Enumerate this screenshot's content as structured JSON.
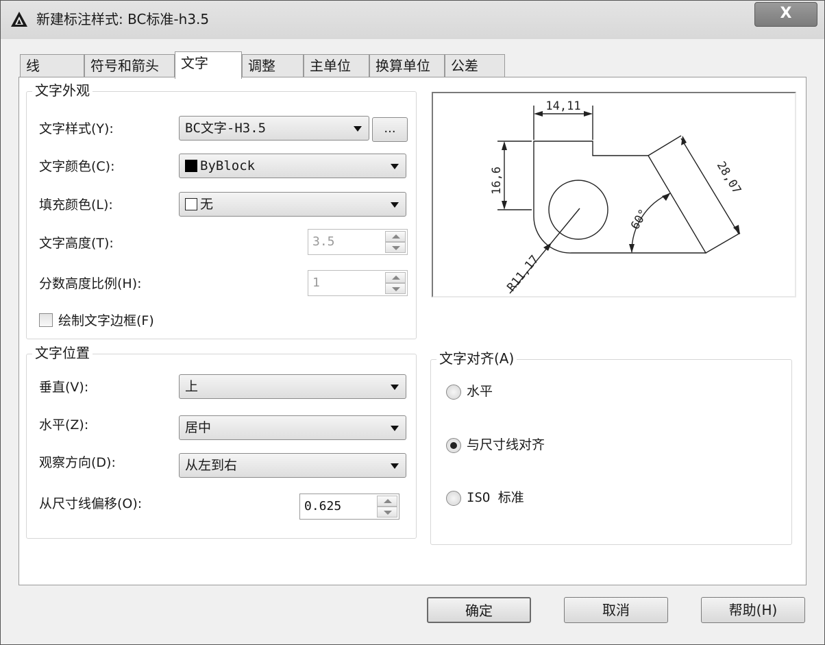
{
  "window": {
    "title": "新建标注样式: BC标准-h3.5",
    "close_label": "X"
  },
  "tabs": [
    {
      "label": "线",
      "active": false
    },
    {
      "label": "符号和箭头",
      "active": false
    },
    {
      "label": "文字",
      "active": true
    },
    {
      "label": "调整",
      "active": false
    },
    {
      "label": "主单位",
      "active": false
    },
    {
      "label": "换算单位",
      "active": false
    },
    {
      "label": "公差",
      "active": false
    }
  ],
  "text_appearance": {
    "title": "文字外观",
    "text_style_label": "文字样式(Y):",
    "text_style_value": "BC文字-H3.5",
    "ellipsis_label": "...",
    "text_color_label": "文字颜色(C):",
    "text_color_value": "ByBlock",
    "text_color_swatch": "#000000",
    "fill_color_label": "填充颜色(L):",
    "fill_color_value": "无",
    "fill_color_swatch": "#ffffff",
    "text_height_label": "文字高度(T):",
    "text_height_value": "3.5",
    "fraction_scale_label": "分数高度比例(H):",
    "fraction_scale_value": "1",
    "draw_frame_label": "绘制文字边框(F)",
    "draw_frame_checked": false
  },
  "text_placement": {
    "title": "文字位置",
    "vertical_label": "垂直(V):",
    "vertical_value": "上",
    "horizontal_label": "水平(Z):",
    "horizontal_value": "居中",
    "view_direction_label": "观察方向(D):",
    "view_direction_value": "从左到右",
    "offset_label": "从尺寸线偏移(O):",
    "offset_value": "0.625"
  },
  "text_alignment": {
    "title": "文字对齐(A)",
    "options": [
      {
        "label": "水平",
        "checked": false
      },
      {
        "label": "与尺寸线对齐",
        "checked": true
      },
      {
        "label": "ISO 标准",
        "checked": false
      }
    ]
  },
  "preview": {
    "dim_top": "14,11",
    "dim_left": "16,6",
    "dim_diagonal": "28,07",
    "dim_angle": "60°",
    "dim_radius": "R11,17"
  },
  "buttons": {
    "ok": "确定",
    "cancel": "取消",
    "help": "帮助(H)"
  }
}
